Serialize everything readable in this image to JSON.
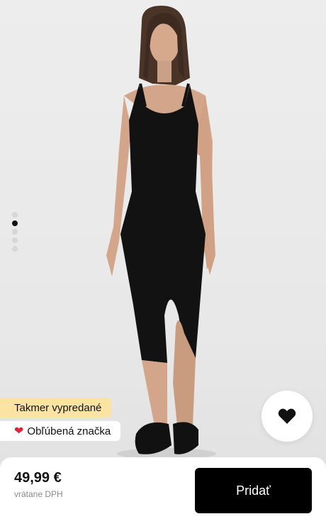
{
  "gallery": {
    "image_alt": "",
    "dots_total": 5,
    "dots_active_index": 1
  },
  "badges": {
    "almost_sold_out": "Takmer vypredané",
    "favorite_brand": "Obľúbená značka"
  },
  "icons": {
    "favorite": "heart-icon",
    "favorite_brand": "heart-icon"
  },
  "colors": {
    "sold_badge_bg": "#fbe4a3",
    "heart_red": "#e0223a",
    "button_bg": "#000000"
  },
  "purchase": {
    "price": "49,99 €",
    "vat_note": "vrátane DPH",
    "add_label": "Pridať"
  }
}
